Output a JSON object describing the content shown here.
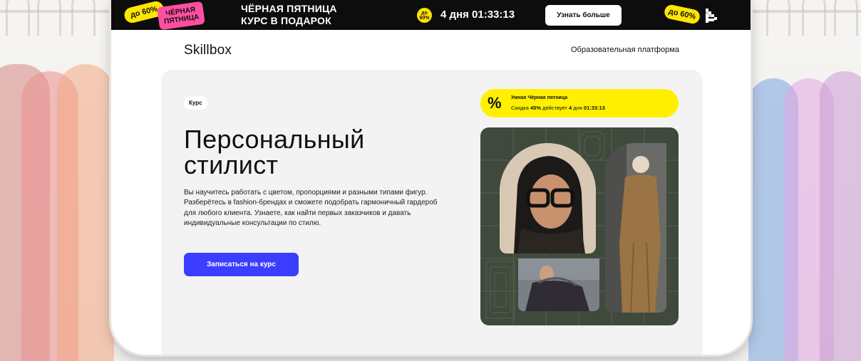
{
  "promo": {
    "discount_left": "до 60%",
    "sticker": "ЧЁРНАЯ ПЯТНИЦА",
    "headline_line1": "ЧЁРНАЯ ПЯТНИЦА",
    "headline_line2": "КУРС В ПОДАРОК",
    "badge_top": "до",
    "badge_bottom": "60%",
    "timer": "4 дня 01:33:13",
    "more_button": "Узнать больше",
    "discount_right": "до 60%"
  },
  "header": {
    "logo": "Skillbox",
    "platform": "Образовательная платформа"
  },
  "hero": {
    "chip": "Курс",
    "title_line1": "Персональный",
    "title_line2": "стилист",
    "description": "Вы научитесь работать с цветом, пропорциями и разными типами фигур. Разберётесь в fashion-брендах и сможете подобрать гармоничный гардероб для любого клиента. Узнаете, как найти первых заказчиков и давать индивидуальные консультации по стилю.",
    "cta": "Записаться на курс"
  },
  "smart_banner": {
    "symbol": "%",
    "title": "Умная Чёрная пятница",
    "prefix": "Скидка",
    "percent": "45%",
    "middle": "действует",
    "days": "4",
    "days_word": "дня",
    "time": "01:33:13"
  },
  "colors": {
    "promo_bg": "#0d0d0d",
    "accent_yellow": "#ffe600",
    "accent_pink": "#ff4fa3",
    "cta_blue": "#3b3efe",
    "hero_bg": "#f3f3f3",
    "gallery_bg": "#3f4a3d"
  }
}
